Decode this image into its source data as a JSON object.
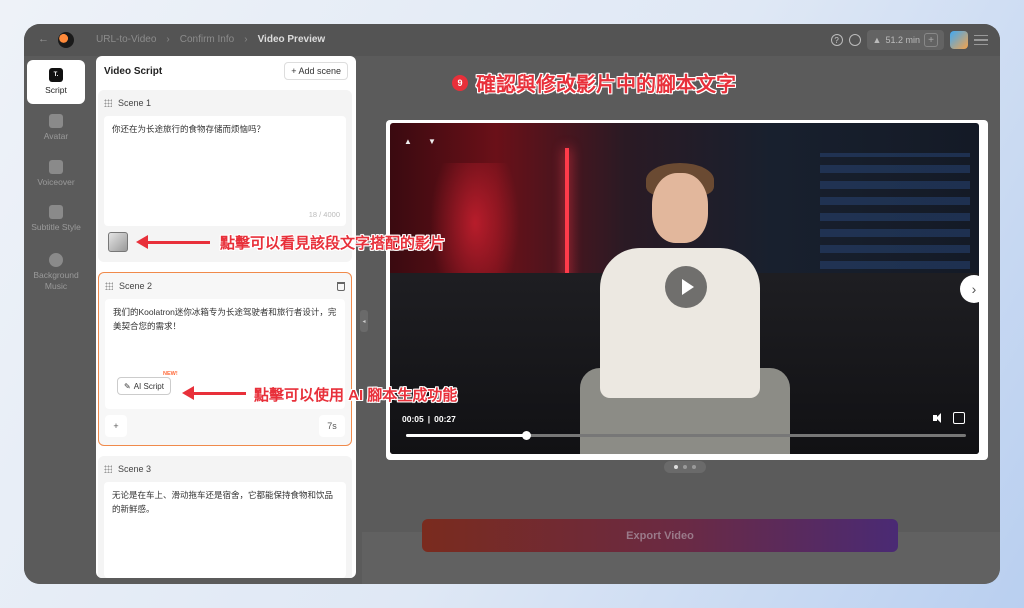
{
  "breadcrumbs": [
    "URL-to-Video",
    "Confirm Info",
    "Video Preview"
  ],
  "header": {
    "minutes": "51.2 min"
  },
  "sidebar": {
    "items": [
      {
        "label": "Script",
        "icon": "script-icon",
        "active": true
      },
      {
        "label": "Avatar",
        "icon": "avatar-icon"
      },
      {
        "label": "Voiceover",
        "icon": "voiceover-icon"
      },
      {
        "label": "Subtitle Style",
        "icon": "subtitle-icon"
      },
      {
        "label": "Background Music",
        "icon": "music-icon"
      }
    ]
  },
  "script_panel": {
    "title": "Video Script",
    "add_scene_label": "+ Add scene",
    "scenes": [
      {
        "label": "Scene 1",
        "text": "你还在为长途旅行的食物存储而烦恼吗？",
        "count": "18 / 4000"
      },
      {
        "label": "Scene 2",
        "text": "我们的Koolatron迷你冰箱专为长途驾驶者和旅行者设计，完美契合您的需求！",
        "ai_label": "AI Script",
        "new_badge": "NEW!",
        "plus": "+",
        "duration": "7s"
      },
      {
        "label": "Scene 3",
        "text": "无论是在车上、滑动拖车还是宿舍，它都能保持食物和饮品的新鲜感。"
      }
    ]
  },
  "video": {
    "current_time": "00:05",
    "separator": "|",
    "total_time": "00:27",
    "progress": 0.215
  },
  "export_label": "Export Video",
  "annotations": {
    "step": "9",
    "title": "確認與修改影片中的腳本文字",
    "hint_thumbnail": "點擊可以看見該段文字搭配的影片",
    "hint_ai": "點擊可以使用 AI 腳本生成功能"
  },
  "colors": {
    "annotation": "#e8303a",
    "selected_border": "#f08a4b",
    "export_start": "#7a2b1e",
    "export_end": "#4a2a74"
  }
}
